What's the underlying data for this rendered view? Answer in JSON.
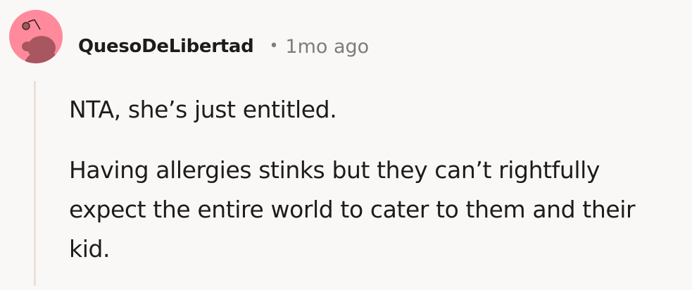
{
  "comment": {
    "username": "QuesoDeLibertad",
    "separator": "•",
    "timestamp": "1mo ago",
    "paragraphs": [
      "NTA, she’s just entitled.",
      "Having allergies stinks but they can’t rightfully expect the entire world to cater to them and their kid."
    ]
  },
  "avatar": {
    "icon": "snoo-avatar-icon",
    "background_color": "#ff8a9b",
    "figure_color": "#a8565f"
  },
  "colors": {
    "background": "#faf8f6",
    "text": "#1c1c1c",
    "meta": "#7c7c7c",
    "thread_line": "#e9e0da"
  }
}
